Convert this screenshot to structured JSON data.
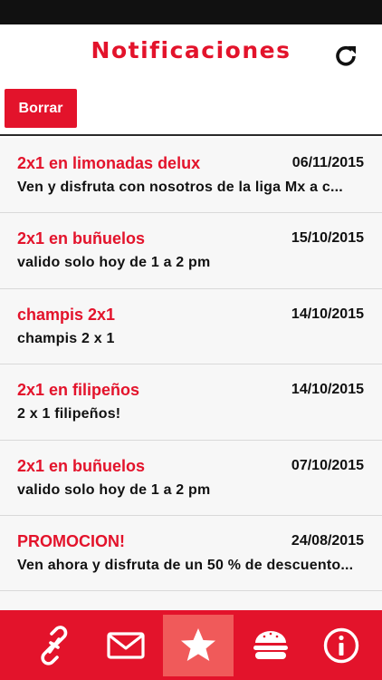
{
  "header": {
    "title": "Notificaciones",
    "refresh_icon": "refresh-icon"
  },
  "toolbar": {
    "clear_label": "Borrar"
  },
  "notifications": [
    {
      "title": "2x1 en limonadas delux",
      "date": "06/11/2015",
      "body": "Ven y disfruta con nosotros de la liga Mx a c..."
    },
    {
      "title": "2x1 en buñuelos",
      "date": "15/10/2015",
      "body": "valido solo hoy de 1 a 2 pm"
    },
    {
      "title": "champis 2x1",
      "date": "14/10/2015",
      "body": "champis 2 x 1"
    },
    {
      "title": "2x1 en filipeños",
      "date": "14/10/2015",
      "body": "2 x 1 filipeños!"
    },
    {
      "title": "2x1 en buñuelos",
      "date": "07/10/2015",
      "body": "valido solo hoy de 1 a 2 pm"
    },
    {
      "title": "PROMOCION!",
      "date": "24/08/2015",
      "body": "Ven ahora y disfruta de un 50 % de descuento..."
    }
  ],
  "tabbar": {
    "tabs": [
      {
        "icon": "link-icon",
        "active": false
      },
      {
        "icon": "mail-icon",
        "active": false
      },
      {
        "icon": "star-icon",
        "active": true
      },
      {
        "icon": "burger-icon",
        "active": false
      },
      {
        "icon": "info-icon",
        "active": false
      }
    ]
  },
  "colors": {
    "brand_red": "#e3132b",
    "active_tab": "#f05a5a",
    "list_background": "#f7f7f7"
  }
}
